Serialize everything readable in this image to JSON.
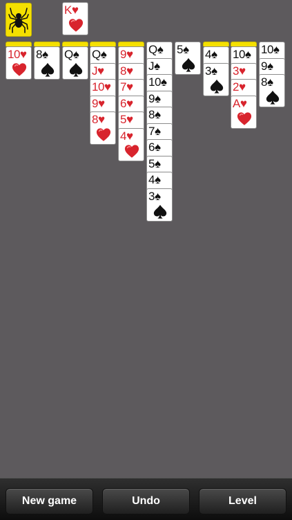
{
  "colors": {
    "background": "#5d5a5d",
    "card_back": "#f5e000",
    "red_suit": "#d8242d",
    "black_suit": "#111111"
  },
  "stock": {
    "icon": "spider-icon"
  },
  "foundation": [
    {
      "rank": "K",
      "suit": "hearts"
    }
  ],
  "tableau": [
    {
      "facedown": 1,
      "cards": [
        {
          "rank": "10",
          "suit": "hearts"
        }
      ]
    },
    {
      "facedown": 1,
      "cards": [
        {
          "rank": "8",
          "suit": "spades"
        }
      ]
    },
    {
      "facedown": 1,
      "cards": [
        {
          "rank": "Q",
          "suit": "spades"
        }
      ]
    },
    {
      "facedown": 1,
      "cards": [
        {
          "rank": "Q",
          "suit": "spades"
        },
        {
          "rank": "J",
          "suit": "hearts"
        },
        {
          "rank": "10",
          "suit": "hearts"
        },
        {
          "rank": "9",
          "suit": "hearts"
        },
        {
          "rank": "8",
          "suit": "hearts"
        }
      ]
    },
    {
      "facedown": 1,
      "cards": [
        {
          "rank": "9",
          "suit": "hearts"
        },
        {
          "rank": "8",
          "suit": "hearts"
        },
        {
          "rank": "7",
          "suit": "hearts"
        },
        {
          "rank": "6",
          "suit": "hearts"
        },
        {
          "rank": "5",
          "suit": "hearts"
        },
        {
          "rank": "4",
          "suit": "hearts"
        }
      ]
    },
    {
      "facedown": 0,
      "cards": [
        {
          "rank": "Q",
          "suit": "spades"
        },
        {
          "rank": "J",
          "suit": "spades"
        },
        {
          "rank": "10",
          "suit": "spades"
        },
        {
          "rank": "9",
          "suit": "spades"
        },
        {
          "rank": "8",
          "suit": "spades"
        },
        {
          "rank": "7",
          "suit": "spades"
        },
        {
          "rank": "6",
          "suit": "spades"
        },
        {
          "rank": "5",
          "suit": "spades"
        },
        {
          "rank": "4",
          "suit": "spades"
        },
        {
          "rank": "3",
          "suit": "spades"
        }
      ]
    },
    {
      "facedown": 0,
      "cards": [
        {
          "rank": "5",
          "suit": "spades"
        }
      ]
    },
    {
      "facedown": 1,
      "cards": [
        {
          "rank": "4",
          "suit": "spades"
        },
        {
          "rank": "3",
          "suit": "spades"
        }
      ]
    },
    {
      "facedown": 1,
      "cards": [
        {
          "rank": "10",
          "suit": "spades"
        },
        {
          "rank": "3",
          "suit": "hearts"
        },
        {
          "rank": "2",
          "suit": "hearts"
        },
        {
          "rank": "A",
          "suit": "hearts"
        }
      ]
    },
    {
      "facedown": 0,
      "cards": [
        {
          "rank": "10",
          "suit": "spades"
        },
        {
          "rank": "9",
          "suit": "spades"
        },
        {
          "rank": "8",
          "suit": "spades"
        }
      ]
    }
  ],
  "toolbar": {
    "new_game_label": "New game",
    "undo_label": "Undo",
    "level_label": "Level"
  }
}
